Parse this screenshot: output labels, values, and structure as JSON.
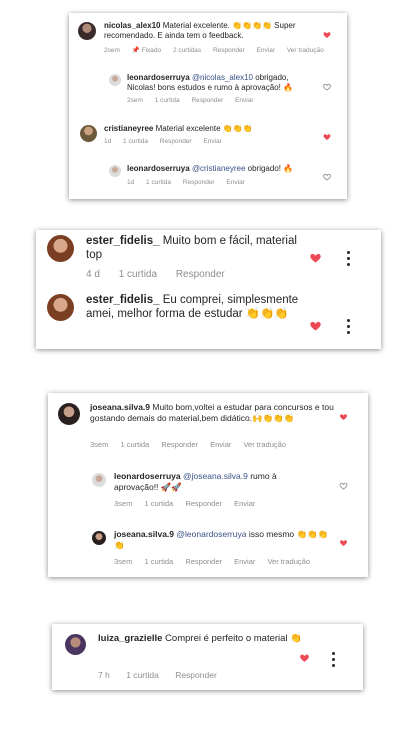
{
  "colors": {
    "like_red": "#ed4956",
    "text": "#262626",
    "muted": "#8e8e8e",
    "mention": "#385185"
  },
  "card1": {
    "c1": {
      "user": "nicolas_alex10",
      "text": "Material excelente. 👏👏👏👏 Super recomendado. E ainda tem o feedback.",
      "time": "2sem",
      "pinned": "Fixado",
      "likes": "2 curtidas",
      "reply": "Responder",
      "send": "Enviar",
      "translate": "Ver tradução"
    },
    "r1": {
      "user": "leonardoserruya",
      "mention": "@nicolas_alex10",
      "text": " obrigado, Nicolas! bons estudos e rumo à aprovação! 🔥",
      "time": "2sem",
      "likes": "1 curtida",
      "reply": "Responder",
      "send": "Enviar"
    },
    "c2": {
      "user": "cristianeyree",
      "text": " Material excelente 👏👏👏",
      "time": "1d",
      "likes": "1 curtida",
      "reply": "Responder",
      "send": "Enviar"
    },
    "r2": {
      "user": "leonardoserruya",
      "mention": "@cristianeyree",
      "text": " obrigado! 🔥",
      "time": "1d",
      "likes": "1 curtida",
      "reply": "Responder",
      "send": "Enviar"
    }
  },
  "card2": {
    "c1": {
      "user": "ester_fidelis_",
      "text": " Muito bom e fácil, material top",
      "time": "4 d",
      "likes": "1 curtida",
      "reply": "Responder"
    },
    "c2": {
      "user": "ester_fidelis_",
      "text": " Eu comprei, simplesmente amei, melhor forma de estudar 👏👏👏"
    }
  },
  "card3": {
    "c1": {
      "user": "joseana.silva.9",
      "text": " Muito bom,voltei a estudar para concursos e tou gostando demais do material,bem didático.🙌👏👏👏",
      "time": "3sem",
      "likes": "1 curtida",
      "reply": "Responder",
      "send": "Enviar",
      "translate": "Ver tradução"
    },
    "r1": {
      "user": "leonardoserruya",
      "mention": "@joseana.silva.9",
      "text": " rumo à aprovação!! 🚀🚀",
      "time": "3sem",
      "likes": "1 curtida",
      "reply": "Responder",
      "send": "Enviar"
    },
    "r2": {
      "user": "joseana.silva.9",
      "mention": "@leonardoserruya",
      "text": " isso mesmo 👏👏👏👏",
      "time": "3sem",
      "likes": "1 curtida",
      "reply": "Responder",
      "send": "Enviar",
      "translate": "Ver tradução"
    }
  },
  "card4": {
    "c1": {
      "user": "luiza_grazielle",
      "text": " Comprei é perfeito o material 👏",
      "time": "7 h",
      "likes": "1 curtida",
      "reply": "Responder"
    }
  }
}
